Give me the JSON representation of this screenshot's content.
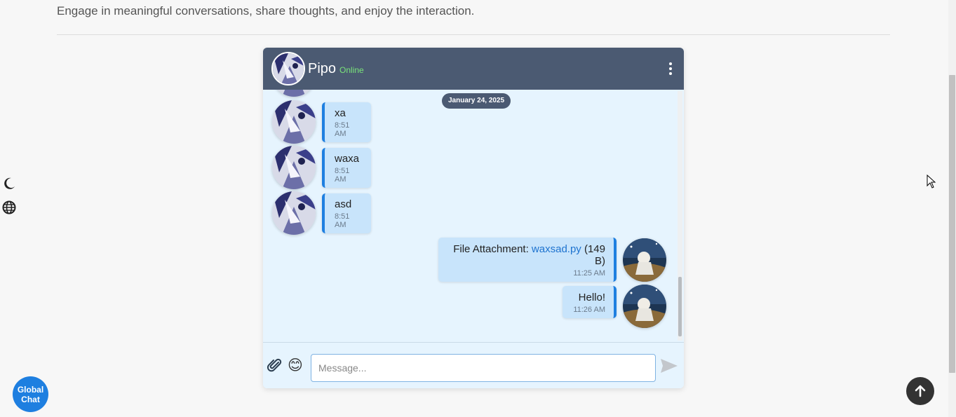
{
  "page": {
    "intro": "Engage in meaningful conversations, share thoughts, and enjoy the interaction."
  },
  "side_tools": {
    "theme_icon": "moon-icon",
    "language_icon": "globe-icon"
  },
  "chat": {
    "contact_name": "Pipo",
    "status": "Online",
    "date_label": "January 24, 2025",
    "messages": [
      {
        "direction": "incoming",
        "text": "xa",
        "time": "8:51 AM"
      },
      {
        "direction": "incoming",
        "text": "waxa",
        "time": "8:51 AM"
      },
      {
        "direction": "incoming",
        "text": "asd",
        "time": "8:51 AM"
      },
      {
        "direction": "outgoing",
        "prefix": "File Attachment: ",
        "file_name": "waxsad.py",
        "file_size": " (149 B)",
        "time": "11:25 AM"
      },
      {
        "direction": "outgoing",
        "text": "Hello!",
        "time": "11:26 AM"
      }
    ],
    "input_placeholder": "Message...",
    "emoji": "😊"
  },
  "global_chat_label": "Global Chat",
  "colors": {
    "header": "#4b5a72",
    "accent": "#1e7fe0",
    "status": "#7ae37a",
    "bubble": "#c8e4fb",
    "chat_bg": "#e6f4fe"
  }
}
